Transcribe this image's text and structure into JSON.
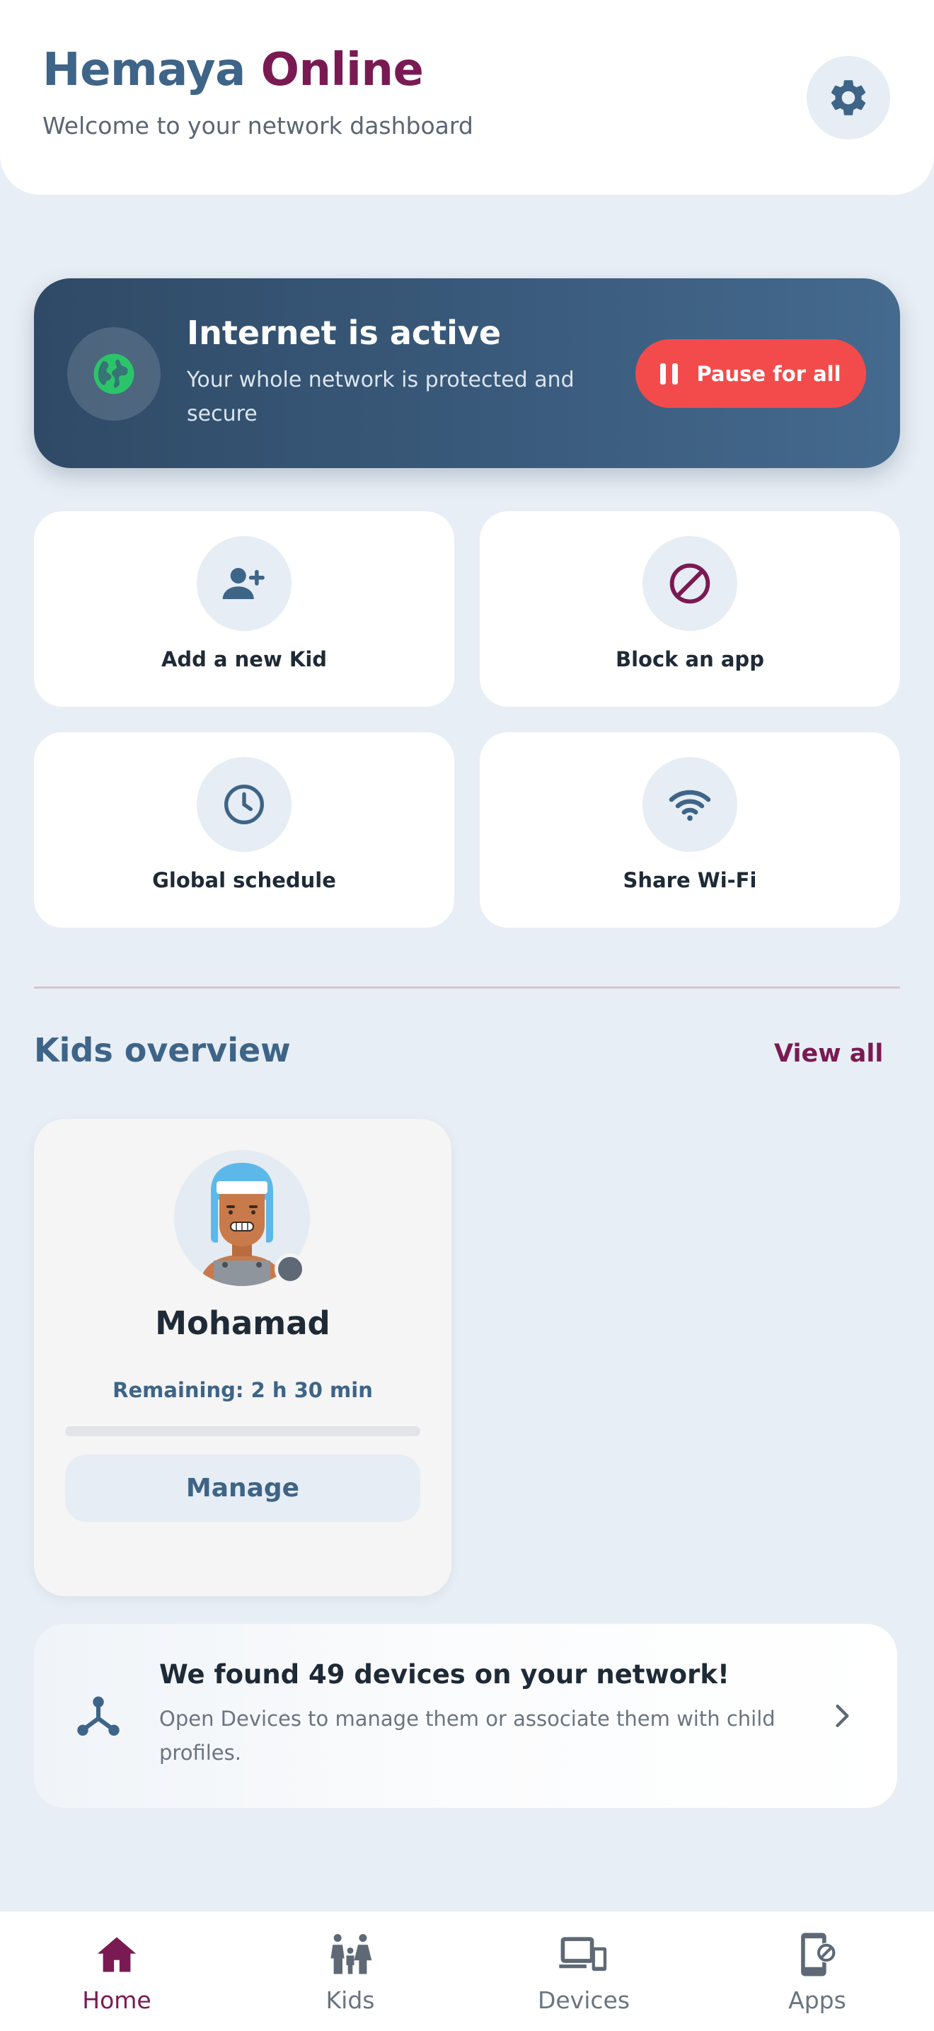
{
  "header": {
    "title_part1": "Hemaya",
    "title_part2": "Online",
    "subtitle": "Welcome to your network dashboard",
    "settings_icon": "gear-icon"
  },
  "status_banner": {
    "title": "Internet is active",
    "description": "Your whole network is protected and secure",
    "pause_button": "Pause for all",
    "icon": "globe-icon"
  },
  "quick_actions": [
    {
      "label": "Add a new Kid",
      "icon": "add-user-icon"
    },
    {
      "label": "Block an app",
      "icon": "block-icon"
    },
    {
      "label": "Global schedule",
      "icon": "clock-icon"
    },
    {
      "label": "Share Wi-Fi",
      "icon": "wifi-icon"
    }
  ],
  "kids_overview": {
    "title": "Kids overview",
    "view_all": "View all",
    "kids": [
      {
        "name": "Mohamad",
        "remaining": "Remaining: 2 h 30 min",
        "progress": 0,
        "manage_label": "Manage",
        "status": "offline"
      }
    ]
  },
  "devices_notice": {
    "title": "We found 49 devices on your network!",
    "description": "Open Devices to manage them or associate them with child profiles.",
    "icon": "network-icon"
  },
  "bottom_nav": [
    {
      "label": "Home",
      "icon": "home-icon",
      "active": true
    },
    {
      "label": "Kids",
      "icon": "family-icon",
      "active": false
    },
    {
      "label": "Devices",
      "icon": "devices-icon",
      "active": false
    },
    {
      "label": "Apps",
      "icon": "app-block-icon",
      "active": false
    }
  ],
  "colors": {
    "primary": "#3e6487",
    "accent": "#7a1a52",
    "danger": "#f34b4b",
    "active_green": "#2cc46b",
    "background": "#e8eef5"
  }
}
